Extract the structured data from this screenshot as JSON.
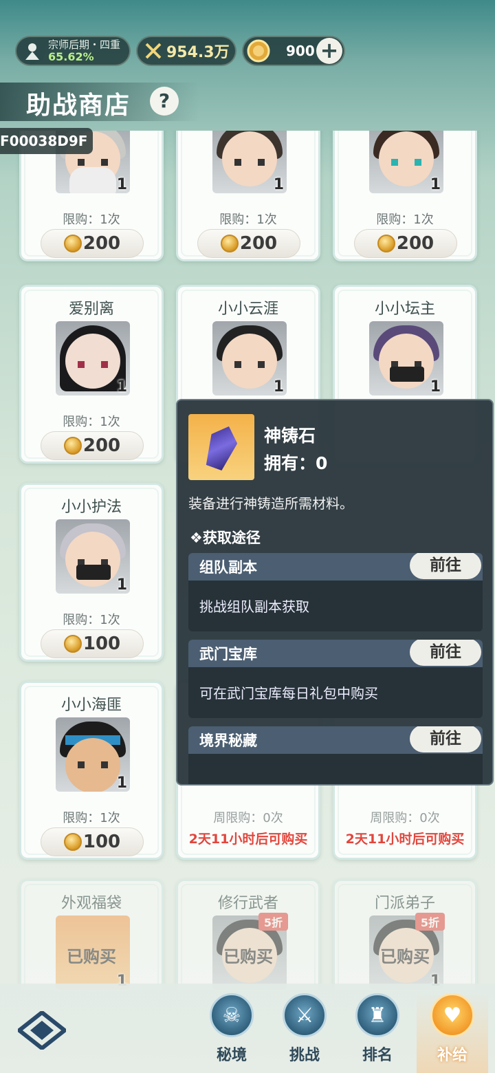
{
  "status": {
    "rank_title": "宗师后期・四重",
    "rank_percent": "65.62%",
    "power": "954.3万",
    "coins": "900",
    "plus_label": "+"
  },
  "header": {
    "title": "助战商店",
    "help_label": "?",
    "debug_id": "F00038D9F"
  },
  "shop": {
    "items": [
      {
        "name": "",
        "qty": "1",
        "limit": "限购：1次",
        "price": "200"
      },
      {
        "name": "",
        "qty": "1",
        "limit": "限购：1次",
        "price": "200"
      },
      {
        "name": "",
        "qty": "1",
        "limit": "限购：1次",
        "price": "200"
      },
      {
        "name": "爱别离",
        "qty": "1",
        "limit": "限购：1次",
        "price": "200"
      },
      {
        "name": "小小云涯",
        "qty": "1",
        "limit": "",
        "price": ""
      },
      {
        "name": "小小坛主",
        "qty": "1",
        "limit": "",
        "price": ""
      },
      {
        "name": "小小护法",
        "qty": "1",
        "limit": "限购：1次",
        "price": "100"
      },
      {
        "name": "小小海匪",
        "qty": "1",
        "limit": "限购：1次",
        "price": "100"
      },
      {
        "name": "",
        "qty": "",
        "limit": "周限购：0次",
        "wait": "2天11小时后可购买"
      },
      {
        "name": "",
        "qty": "",
        "limit": "周限购：0次",
        "wait": "2天11小时后可购买"
      },
      {
        "name": "外观福袋",
        "qty": "1",
        "status": "已购买"
      },
      {
        "name": "修行武者",
        "qty": "",
        "status": "已购买",
        "discount": "5折"
      },
      {
        "name": "门派弟子",
        "qty": "1",
        "status": "已购买",
        "discount": "5折"
      }
    ]
  },
  "tooltip": {
    "item_name": "神铸石",
    "owned": "拥有：0",
    "description": "装备进行神铸造所需材料。",
    "sources_heading": "❖获取途径",
    "sources": [
      {
        "title": "组队副本",
        "button": "前往",
        "desc": "挑战组队副本获取"
      },
      {
        "title": "武门宝库",
        "button": "前往",
        "desc": "可在武门宝库每日礼包中购买"
      },
      {
        "title": "境界秘藏",
        "button": "前往",
        "desc": ""
      }
    ]
  },
  "nav": {
    "items": [
      {
        "label": "秘境"
      },
      {
        "label": "挑战"
      },
      {
        "label": "排名"
      },
      {
        "label": "补给"
      }
    ]
  },
  "colors": {
    "accent_orange": "#f29a2a",
    "price_red": "#e2463c",
    "rank_green": "#b9f08a"
  }
}
